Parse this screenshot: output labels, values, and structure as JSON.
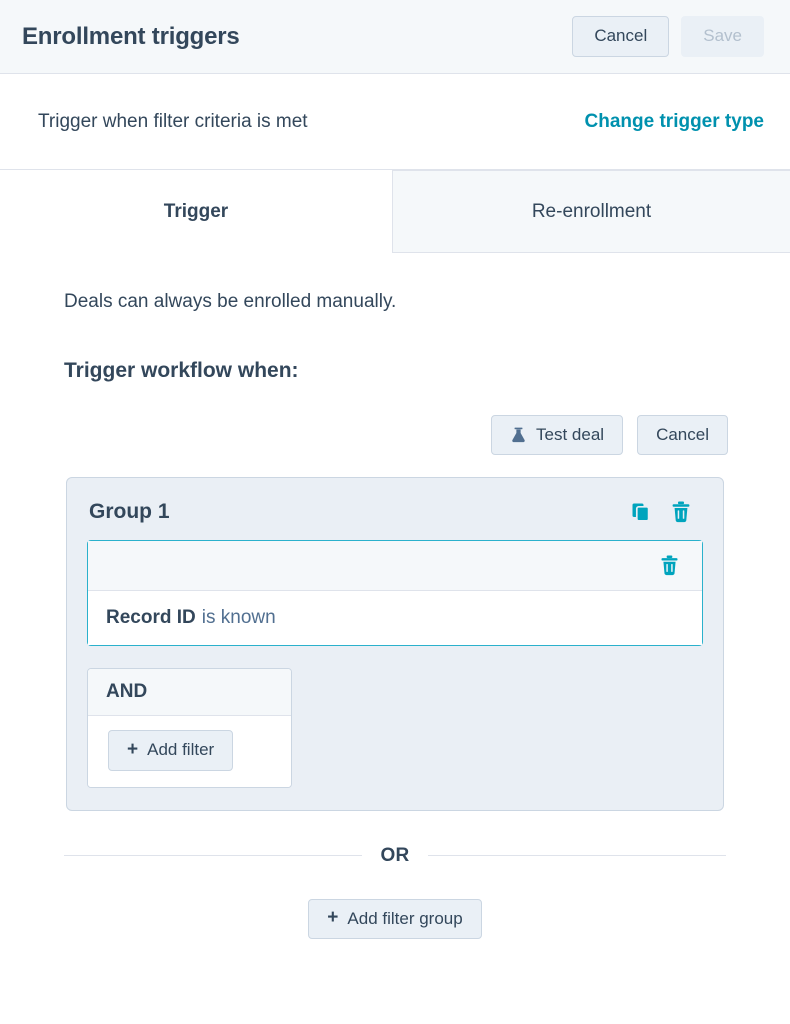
{
  "header": {
    "title": "Enrollment triggers",
    "cancel_label": "Cancel",
    "save_label": "Save"
  },
  "subheader": {
    "text": "Trigger when filter criteria is met",
    "change_link": "Change trigger type"
  },
  "tabs": [
    {
      "label": "Trigger",
      "active": true
    },
    {
      "label": "Re-enrollment",
      "active": false
    }
  ],
  "body": {
    "note": "Deals can always be enrolled manually.",
    "section_title": "Trigger workflow when:",
    "test_button": "Test deal",
    "test_button_icon": "flask-icon",
    "cancel_button": "Cancel"
  },
  "filter_group": {
    "name": "Group 1",
    "clone_icon": "copy-icon",
    "delete_icon": "trash-icon",
    "filter": {
      "property": "Record ID",
      "operator": "is known",
      "delete_icon": "trash-icon"
    },
    "operator_box": {
      "label": "AND",
      "add_filter_label": "Add filter",
      "add_icon": "plus-icon"
    }
  },
  "or_divider": {
    "label": "OR"
  },
  "add_group": {
    "label": "Add filter group",
    "add_icon": "plus-icon"
  },
  "colors": {
    "accent_teal": "#00a4bd",
    "link_teal": "#0091ae",
    "focus_border": "#2ab1cc",
    "text_dark": "#33475b",
    "text_muted": "#516f90",
    "disabled_text": "#b3c0ce",
    "surface_light": "#f5f8fa",
    "group_fill": "#eaeff5",
    "border": "#cbd6e2"
  }
}
